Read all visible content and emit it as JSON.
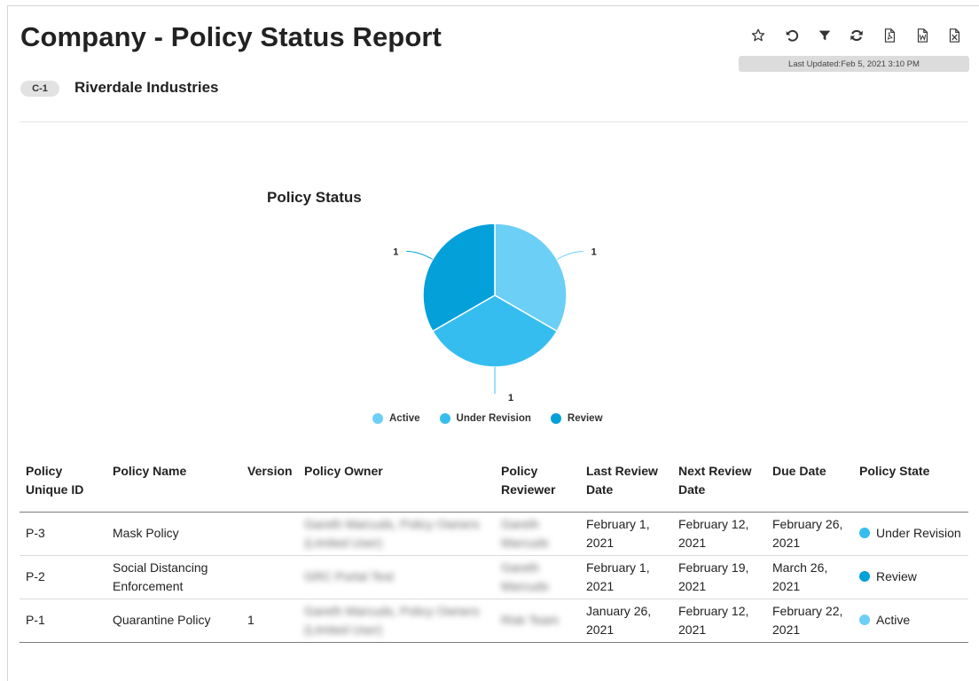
{
  "report": {
    "title": "Company - Policy Status Report",
    "badge": "C-1",
    "company": "Riverdale Industries",
    "last_updated": "Last Updated:Feb 5, 2021 3:10 PM"
  },
  "toolbar": {
    "icons": [
      "star-icon",
      "undo-icon",
      "filter-icon",
      "refresh-icon",
      "pdf-icon",
      "word-icon",
      "excel-icon"
    ]
  },
  "chart_data": {
    "type": "pie",
    "title": "Policy Status",
    "categories": [
      "Active",
      "Under Revision",
      "Review"
    ],
    "values": [
      1,
      1,
      1
    ],
    "data_labels": [
      "1",
      "1",
      "1"
    ],
    "colors": [
      "#6ccff6",
      "#36bdf0",
      "#03a0da"
    ],
    "legend_position": "bottom"
  },
  "table": {
    "headers": [
      "Policy Unique ID",
      "Policy Name",
      "Version",
      "Policy Owner",
      "Policy Reviewer",
      "Last Review Date",
      "Next Review Date",
      "Due Date",
      "Policy State"
    ],
    "rows": [
      {
        "id": "P-3",
        "name": "Mask Policy",
        "version": "",
        "owner": "Gareth Marcuds, Policy Owners (Limited User)",
        "reviewer": "Gareth Marcuds",
        "last_review": "February 1, 2021",
        "next_review": "February 12, 2021",
        "due": "February 26, 2021",
        "state": "Under Revision",
        "state_color": "#36bdf0"
      },
      {
        "id": "P-2",
        "name": "Social Distancing Enforcement",
        "version": "",
        "owner": "GRC Portal Test",
        "reviewer": "Gareth Marcuds",
        "last_review": "February 1, 2021",
        "next_review": "February 19, 2021",
        "due": "March 26, 2021",
        "state": "Review",
        "state_color": "#03a0da"
      },
      {
        "id": "P-1",
        "name": "Quarantine Policy",
        "version": "1",
        "owner": "Gareth Marcuds, Policy Owners (Limited User)",
        "reviewer": "Risk Team",
        "last_review": "January 26, 2021",
        "next_review": "February 12, 2021",
        "due": "February 22, 2021",
        "state": "Active",
        "state_color": "#6ccff6"
      }
    ]
  }
}
